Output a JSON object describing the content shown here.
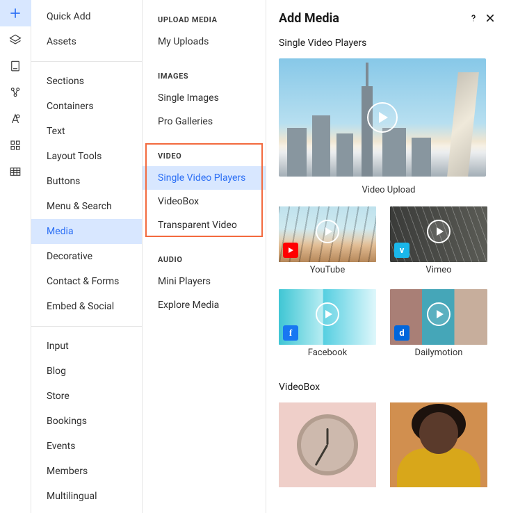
{
  "rail": {
    "items": [
      {
        "name": "add-icon",
        "active": true
      },
      {
        "name": "layers-icon"
      },
      {
        "name": "pages-icon"
      },
      {
        "name": "data-icon"
      },
      {
        "name": "theme-icon"
      },
      {
        "name": "apps-icon"
      },
      {
        "name": "table-icon"
      }
    ]
  },
  "categories": {
    "group_top": [
      {
        "label": "Quick Add"
      },
      {
        "label": "Assets"
      }
    ],
    "group_mid": [
      {
        "label": "Sections"
      },
      {
        "label": "Containers"
      },
      {
        "label": "Text"
      },
      {
        "label": "Layout Tools"
      },
      {
        "label": "Buttons"
      },
      {
        "label": "Menu & Search"
      },
      {
        "label": "Media",
        "active": true
      },
      {
        "label": "Decorative"
      },
      {
        "label": "Contact & Forms"
      },
      {
        "label": "Embed & Social"
      }
    ],
    "group_bot": [
      {
        "label": "Input"
      },
      {
        "label": "Blog"
      },
      {
        "label": "Store"
      },
      {
        "label": "Bookings"
      },
      {
        "label": "Events"
      },
      {
        "label": "Members"
      },
      {
        "label": "Multilingual"
      }
    ]
  },
  "subcats": {
    "upload_heading": "UPLOAD MEDIA",
    "upload_items": [
      {
        "label": "My Uploads"
      }
    ],
    "images_heading": "IMAGES",
    "images_items": [
      {
        "label": "Single Images"
      },
      {
        "label": "Pro Galleries"
      }
    ],
    "video_heading": "VIDEO",
    "video_items": [
      {
        "label": "Single Video Players",
        "active": true
      },
      {
        "label": "VideoBox"
      },
      {
        "label": "Transparent Video"
      }
    ],
    "audio_heading": "AUDIO",
    "audio_items": [
      {
        "label": "Mini Players"
      },
      {
        "label": "Explore Media"
      }
    ]
  },
  "main": {
    "title": "Add Media",
    "section1": "Single Video Players",
    "hero_caption": "Video Upload",
    "providers": [
      {
        "label": "YouTube",
        "brand": "yt",
        "thumb": "bridge"
      },
      {
        "label": "Vimeo",
        "brand": "vm",
        "thumb": "bldg"
      },
      {
        "label": "Facebook",
        "brand": "fb",
        "thumb": "cyan"
      },
      {
        "label": "Dailymotion",
        "brand": "dm",
        "thumb": "teal"
      }
    ],
    "section2": "VideoBox"
  }
}
